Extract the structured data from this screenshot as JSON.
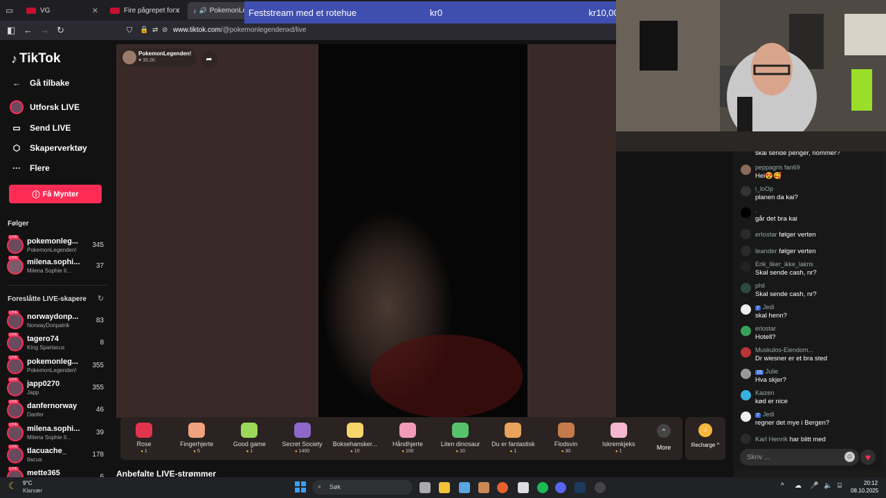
{
  "browser": {
    "tabs": [
      {
        "label": "VG"
      },
      {
        "label": "Fire pågrepet for ran i"
      },
      {
        "label": "PokemonLeg"
      }
    ],
    "url_host": "www.tiktok.com",
    "url_path": "/@pokemonlegendenxd/live"
  },
  "banner": {
    "title": "Feststream med et rotehue",
    "current": "kr0",
    "goal": "kr10,000"
  },
  "sidebar": {
    "logo": "TikTok",
    "menu": [
      {
        "label": "Gå tilbake"
      },
      {
        "label": "Utforsk LIVE"
      },
      {
        "label": "Send LIVE"
      },
      {
        "label": "Skaperverktøy"
      },
      {
        "label": "Flere"
      }
    ],
    "coins_button": "Få Mynter",
    "following_title": "Følger",
    "following": [
      {
        "name": "pokemonleg...",
        "sub": "PokemonLegenden!",
        "count": "345"
      },
      {
        "name": "milena.sophi...",
        "sub": "Milena Sophie Il...",
        "count": "37"
      }
    ],
    "suggested_title": "Foreslåtte LIVE-skapere",
    "suggested": [
      {
        "name": "norwaydonp...",
        "sub": "NorwayDonpatrik",
        "count": "83"
      },
      {
        "name": "tagero74",
        "sub": "King Spartacus",
        "count": "8"
      },
      {
        "name": "pokemonleg...",
        "sub": "PokemonLegenden!",
        "count": "355"
      },
      {
        "name": "japp0270",
        "sub": "Japp",
        "count": "355"
      },
      {
        "name": "danfernorway",
        "sub": "Danfer",
        "count": "46"
      },
      {
        "name": "milena.sophi...",
        "sub": "Milena Sophie Il...",
        "count": "39"
      },
      {
        "name": "tlacuache_",
        "sub": "tlacua",
        "count": "178"
      },
      {
        "name": "mette365",
        "sub": "",
        "count": "6"
      }
    ]
  },
  "player": {
    "host_name": "PokemonLegenden!",
    "host_likes": "35.2K"
  },
  "gifts": [
    {
      "name": "Rose",
      "price": "1",
      "color": "#e0344f"
    },
    {
      "name": "Fingerhjerte",
      "price": "5",
      "color": "#f0a17d"
    },
    {
      "name": "Good game",
      "price": "1",
      "color": "#9bd85a"
    },
    {
      "name": "Secret Society",
      "price": "1400",
      "color": "#8e68c9"
    },
    {
      "name": "Boksehansker...",
      "price": "10",
      "color": "#f6d56a"
    },
    {
      "name": "Håndhjerte",
      "price": "100",
      "color": "#f29ab8"
    },
    {
      "name": "Liten dinosaur",
      "price": "10",
      "color": "#57c26b"
    },
    {
      "name": "Du er fantastisk",
      "price": "1",
      "color": "#e8a35c"
    },
    {
      "name": "Flodsvin",
      "price": "30",
      "color": "#c47a4b"
    },
    {
      "name": "Iskremkjeks",
      "price": "1",
      "color": "#f5b7d0"
    }
  ],
  "gift_more": "More",
  "recharge": "Recharge",
  "recommended_title": "Anbefalte LIVE-strømmer",
  "chat": {
    "messages": [
      {
        "user": "",
        "text": "skal sende penger, nommer?",
        "avatar": "#555"
      },
      {
        "user": "peppagris fan69",
        "text": "Hei😍🥰",
        "avatar": "#8a6a5a"
      },
      {
        "user": "i_loOp",
        "text": "planen da kai?",
        "avatar": "#333"
      },
      {
        "user": ".",
        "text": "går det bra kai",
        "avatar": "#000"
      },
      {
        "user": "erlostar",
        "text": "følger verten",
        "avatar": "#2a2a2a"
      },
      {
        "user": "leander",
        "text": "følger verten",
        "avatar": "#2a2a2a"
      },
      {
        "user": "Erik_liker_ikke_lakris",
        "text": "Skal sende cash, nr?",
        "avatar": "#222"
      },
      {
        "user": "phil",
        "text": "Skal sende cash, nr?",
        "avatar": "#2d4a3f"
      },
      {
        "user": "Jedi",
        "text": "skal henn?",
        "avatar": "#eee",
        "badge": "7"
      },
      {
        "user": "erlostar",
        "text": "Hotell?",
        "avatar": "#3aa15a"
      },
      {
        "user": "Muskulos-Eiendom...",
        "text": "Dr wiesner er et bra sted",
        "avatar": "#b33"
      },
      {
        "user": "Julie",
        "text": "Hva skjer?",
        "avatar": "#999",
        "badge": "15"
      },
      {
        "user": "Kaizen",
        "text": "kød er nice",
        "avatar": "#3ab0e0"
      },
      {
        "user": "Jedi",
        "text": "regner det mye i Bergen?",
        "avatar": "#eee",
        "badge": "7"
      },
      {
        "user": "Karl Henrik",
        "text": "har blitt med",
        "avatar": "#2a2a2a"
      }
    ],
    "input_placeholder": "Skriv ..."
  },
  "taskbar": {
    "weather_temp": "9°C",
    "weather_desc": "Klarvær",
    "search": "Søk",
    "time": "20:12",
    "date": "08.10.2025"
  }
}
